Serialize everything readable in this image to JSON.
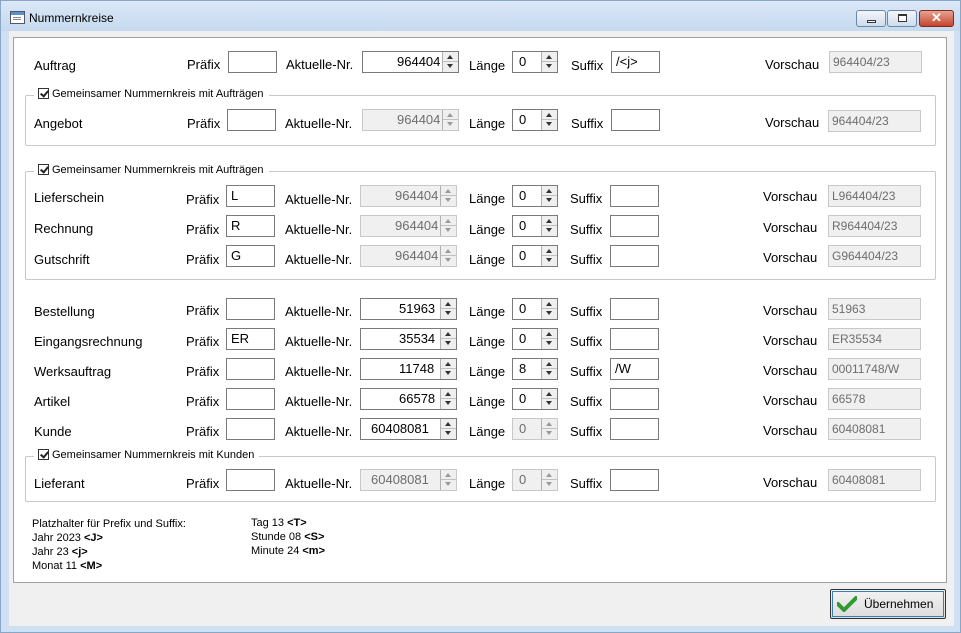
{
  "window": {
    "title": "Nummernkreise"
  },
  "labels": {
    "prefix": "Präfix",
    "current": "Aktuelle-Nr.",
    "length": "Länge",
    "suffix": "Suffix",
    "preview": "Vorschau"
  },
  "groups": {
    "shared_orders_1": "Gemeinsamer Nummernkreis mit Aufträgen",
    "shared_orders_2": "Gemeinsamer Nummernkreis mit Aufträgen",
    "shared_customers": "Gemeinsamer Nummernkreis mit Kunden"
  },
  "rows": [
    {
      "name": "Auftrag",
      "prefix": "",
      "current": "964404",
      "length": "0",
      "suffix": "/<j>",
      "preview": "964404/23"
    },
    {
      "name": "Angebot",
      "prefix": "",
      "current": "964404",
      "length": "0",
      "suffix": "",
      "preview": "964404/23"
    },
    {
      "name": "Lieferschein",
      "prefix": "L",
      "current": "964404",
      "length": "0",
      "suffix": "",
      "preview": "L964404/23"
    },
    {
      "name": "Rechnung",
      "prefix": "R",
      "current": "964404",
      "length": "0",
      "suffix": "",
      "preview": "R964404/23"
    },
    {
      "name": "Gutschrift",
      "prefix": "G",
      "current": "964404",
      "length": "0",
      "suffix": "",
      "preview": "G964404/23"
    },
    {
      "name": "Bestellung",
      "prefix": "",
      "current": "51963",
      "length": "0",
      "suffix": "",
      "preview": "51963"
    },
    {
      "name": "Eingangsrechnung",
      "prefix": "ER",
      "current": "35534",
      "length": "0",
      "suffix": "",
      "preview": "ER35534"
    },
    {
      "name": "Werksauftrag",
      "prefix": "",
      "current": "11748",
      "length": "8",
      "suffix": "/W",
      "preview": "00011748/W"
    },
    {
      "name": "Artikel",
      "prefix": "",
      "current": "66578",
      "length": "0",
      "suffix": "",
      "preview": "66578"
    },
    {
      "name": "Kunde",
      "prefix": "",
      "current": "60408081",
      "length": "0",
      "suffix": "",
      "preview": "60408081"
    },
    {
      "name": "Lieferant",
      "prefix": "",
      "current": "60408081",
      "length": "0",
      "suffix": "",
      "preview": "60408081"
    }
  ],
  "help": {
    "title": "Platzhalter für Prefix und Suffix:",
    "year4_label": "Jahr 2023",
    "year4_token": "<J>",
    "year2_label": "Jahr 23",
    "year2_token": "<j>",
    "month_label": "Monat 11",
    "month_token": "<M>",
    "day_label": "Tag 13",
    "day_token": "<T>",
    "hour_label": "Stunde 08",
    "hour_token": "<S>",
    "minute_label": "Minute 24",
    "minute_token": "<m>"
  },
  "buttons": {
    "apply": "Übernehmen"
  }
}
